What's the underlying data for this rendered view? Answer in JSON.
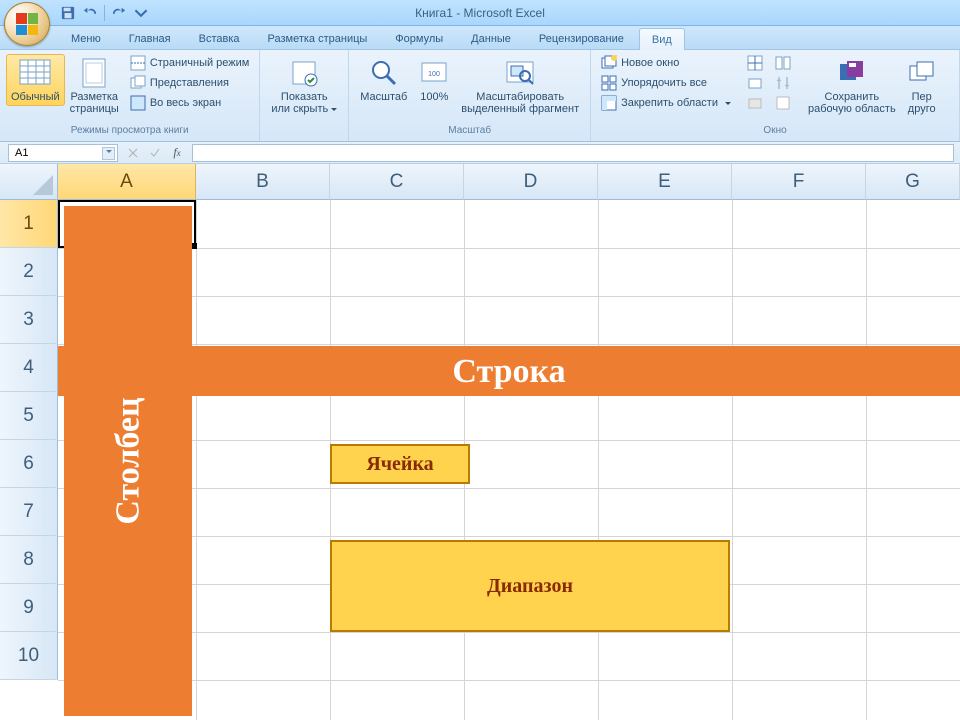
{
  "title": "Книга1 - Microsoft Excel",
  "qat": {
    "save": "save",
    "undo": "undo",
    "redo": "redo"
  },
  "tabs": {
    "items": [
      "Меню",
      "Главная",
      "Вставка",
      "Разметка страницы",
      "Формулы",
      "Данные",
      "Рецензирование",
      "Вид"
    ],
    "active": 7
  },
  "ribbon": {
    "group_views": {
      "caption": "Режимы просмотра книги",
      "normal": "Обычный",
      "page_layout": "Разметка\nстраницы",
      "page_break": "Страничный режим",
      "custom_views": "Представления",
      "full_screen": "Во весь экран"
    },
    "group_showhide": {
      "show_hide": "Показать\nили скрыть"
    },
    "group_zoom": {
      "caption": "Масштаб",
      "zoom": "Масштаб",
      "hundred": "100%",
      "to_selection": "Масштабировать\nвыделенный фрагмент"
    },
    "group_window": {
      "caption": "Окно",
      "new_window": "Новое окно",
      "arrange_all": "Упорядочить все",
      "freeze_panes": "Закрепить области",
      "save_workspace": "Сохранить\nрабочую область",
      "switch_windows": "Пер\nдруго"
    }
  },
  "namebox": {
    "value": "A1"
  },
  "columns": [
    "A",
    "B",
    "C",
    "D",
    "E",
    "F",
    "G"
  ],
  "rows": [
    "1",
    "2",
    "3",
    "4",
    "5",
    "6",
    "7",
    "8",
    "9",
    "10"
  ],
  "overlays": {
    "column_label": "Столбец",
    "row_label": "Строка",
    "cell_label": "Ячейка",
    "range_label": "Диапазон"
  }
}
